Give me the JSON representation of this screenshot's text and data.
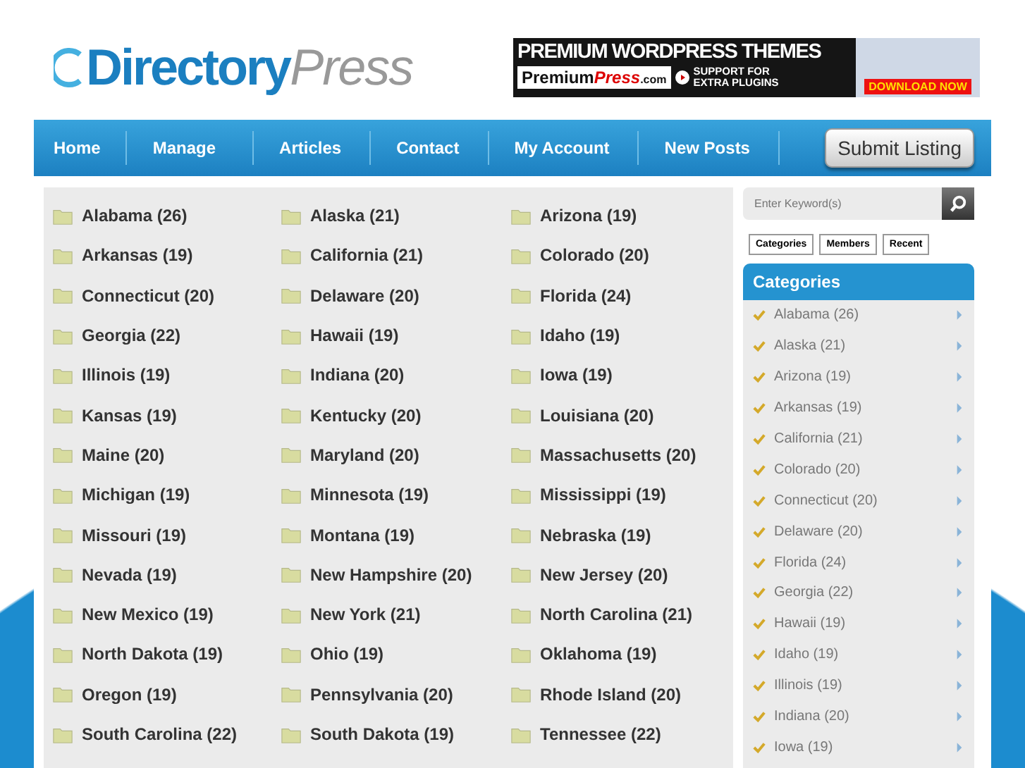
{
  "logo": {
    "part_1": "Directory",
    "part_2": "Press"
  },
  "banner": {
    "headline": "PREMIUM WORDPRESS THEMES",
    "brand_1": "Premium",
    "brand_2": "Press",
    "brand_3": ".com",
    "tagline_1": "SUPPORT FOR",
    "tagline_2": "EXTRA PLUGINS",
    "cta": "DOWNLOAD NOW"
  },
  "nav": {
    "items": [
      "Home",
      "Manage",
      "Articles",
      "Contact",
      "My Account",
      "New Posts"
    ],
    "submit_button": "Submit Listing"
  },
  "categories": [
    "Alabama (26)",
    "Alaska (21)",
    "Arizona (19)",
    "Arkansas (19)",
    "California (21)",
    "Colorado (20)",
    "Connecticut (20)",
    "Delaware (20)",
    "Florida (24)",
    "Georgia (22)",
    "Hawaii (19)",
    "Idaho (19)",
    "Illinois (19)",
    "Indiana (20)",
    "Iowa (19)",
    "Kansas (19)",
    "Kentucky (20)",
    "Louisiana (20)",
    "Maine (20)",
    "Maryland (20)",
    "Massachusetts (20)",
    "Michigan (19)",
    "Minnesota (19)",
    "Mississippi (19)",
    "Missouri (19)",
    "Montana (19)",
    "Nebraska (19)",
    "Nevada (19)",
    "New Hampshire (20)",
    "New Jersey (20)",
    "New Mexico (19)",
    "New York (21)",
    "North Carolina (21)",
    "North Dakota (19)",
    "Ohio (19)",
    "Oklahoma (19)",
    "Oregon (19)",
    "Pennsylvania (20)",
    "Rhode Island (20)",
    "South Carolina (22)",
    "South Dakota (19)",
    "Tennessee (22)"
  ],
  "sidebar": {
    "search": {
      "placeholder": "Enter Keyword(s)"
    },
    "tabs": [
      {
        "label": "Categories",
        "selected": false
      },
      {
        "label": "Members",
        "selected": false
      },
      {
        "label": "Recent",
        "selected": false
      }
    ],
    "heading": "Categories",
    "items": [
      "Alabama (26)",
      "Alaska (21)",
      "Arizona (19)",
      "Arkansas (19)",
      "California (21)",
      "Colorado (20)",
      "Connecticut (20)",
      "Delaware (20)",
      "Florida (24)",
      "Georgia (22)",
      "Hawaii (19)",
      "Idaho (19)",
      "Illinois (19)",
      "Indiana (20)",
      "Iowa (19)"
    ]
  }
}
